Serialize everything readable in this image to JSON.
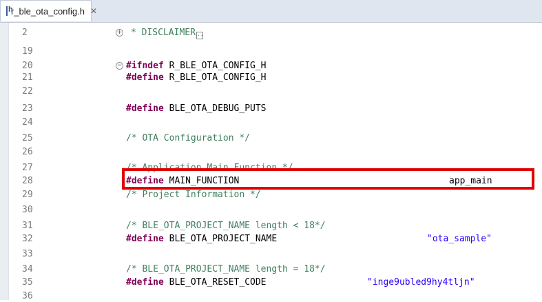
{
  "tab": {
    "filename": "r_ble_ota_config.h",
    "close_symbol": "✕"
  },
  "lines": [
    {
      "n": "2",
      "text": "* DISCLAIMER"
    },
    {
      "n": "19",
      "text": ""
    },
    {
      "n": "20",
      "kw": "#ifndef",
      "rest": " R_BLE_OTA_CONFIG_H"
    },
    {
      "n": "21",
      "kw": "#define",
      "rest": " R_BLE_OTA_CONFIG_H"
    },
    {
      "n": "22",
      "text": ""
    },
    {
      "n": "23",
      "kw": "#define",
      "rest": " BLE_OTA_DEBUG_PUTS"
    },
    {
      "n": "24",
      "text": ""
    },
    {
      "n": "25",
      "comment": "/* OTA Configuration */"
    },
    {
      "n": "26",
      "text": ""
    },
    {
      "n": "27",
      "comment": "/* Application Main Function */"
    },
    {
      "n": "28",
      "kw": "#define",
      "rest": " MAIN_FUNCTION",
      "value": "app_main"
    },
    {
      "n": "29",
      "comment": "/* Project Information */"
    },
    {
      "n": "30",
      "text": ""
    },
    {
      "n": "31",
      "comment": "/* BLE_OTA_PROJECT_NAME length < 18*/"
    },
    {
      "n": "32",
      "kw": "#define",
      "rest": " BLE_OTA_PROJECT_NAME",
      "string": "\"ota_sample\""
    },
    {
      "n": "33",
      "text": ""
    },
    {
      "n": "34",
      "comment": "/* BLE_OTA_PROJECT_NAME length = 18*/"
    },
    {
      "n": "35",
      "kw": "#define",
      "rest": " BLE_OTA_RESET_CODE",
      "string": "\"inge9ubled9hy4tljn\""
    },
    {
      "n": "36",
      "text": ""
    }
  ],
  "colors": {
    "keyword": "#7f0055",
    "comment": "#3f7f5f",
    "string": "#2a00ff",
    "highlight": "#e00000"
  }
}
